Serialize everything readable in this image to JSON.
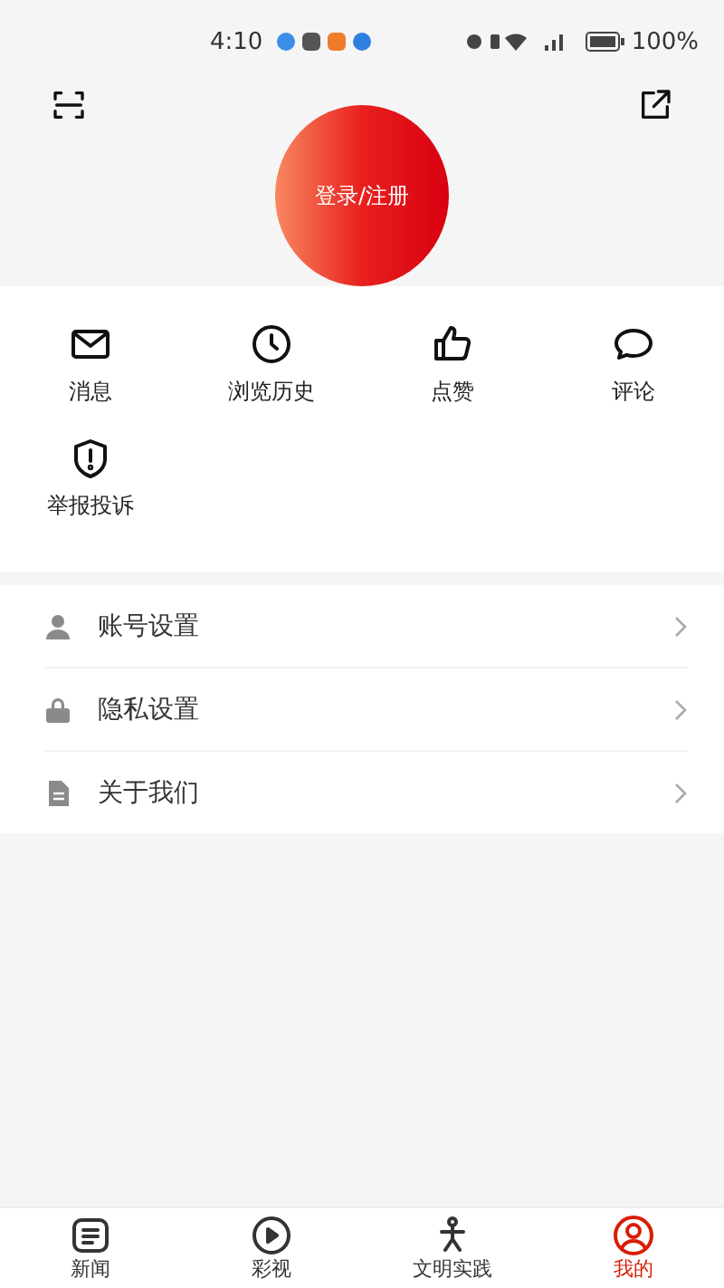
{
  "status_bar": {
    "time": "4:10",
    "battery": "100%"
  },
  "header": {
    "login_button": "登录/注册"
  },
  "shortcuts": [
    {
      "kind": "mail",
      "label": "消息"
    },
    {
      "kind": "clock",
      "label": "浏览历史"
    },
    {
      "kind": "like",
      "label": "点赞"
    },
    {
      "kind": "comment",
      "label": "评论"
    },
    {
      "kind": "report",
      "label": "举报投诉"
    }
  ],
  "settings": [
    {
      "kind": "account",
      "label": "账号设置"
    },
    {
      "kind": "privacy",
      "label": "隐私设置"
    },
    {
      "kind": "about",
      "label": "关于我们"
    }
  ],
  "tab_bar": [
    {
      "kind": "news",
      "label": "新闻",
      "selected": false
    },
    {
      "kind": "video",
      "label": "彩视",
      "selected": false
    },
    {
      "kind": "practice",
      "label": "文明实践",
      "selected": false
    },
    {
      "kind": "me",
      "label": "我的",
      "selected": true
    }
  ]
}
